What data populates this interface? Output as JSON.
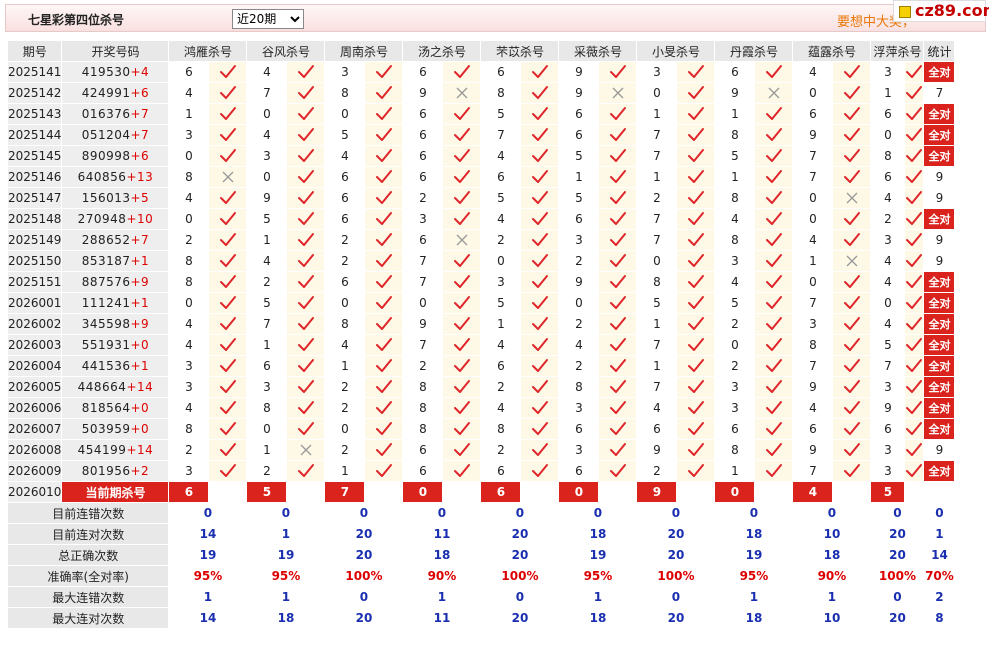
{
  "header": {
    "title": "七星彩第四位杀号",
    "select_value": "近20期",
    "promo": "要想中大奖，",
    "logo": "cz89.com"
  },
  "columns": {
    "period": "期号",
    "draw": "开奖号码",
    "experts": [
      "鸿雁杀号",
      "谷风杀号",
      "周南杀号",
      "汤之杀号",
      "芣苡杀号",
      "采薇杀号",
      "小旻杀号",
      "丹霞杀号",
      "蕴露杀号",
      "浮萍杀号"
    ],
    "stat": "统计"
  },
  "rows": [
    {
      "period": "2025141",
      "nums": "419530",
      "plus": "+4",
      "kills": [
        6,
        4,
        3,
        6,
        6,
        9,
        3,
        6,
        4,
        3
      ],
      "ok": [
        1,
        1,
        1,
        1,
        1,
        1,
        1,
        1,
        1,
        1
      ],
      "stat": "全对"
    },
    {
      "period": "2025142",
      "nums": "424991",
      "plus": "+6",
      "kills": [
        4,
        7,
        8,
        9,
        8,
        9,
        0,
        9,
        0,
        1
      ],
      "ok": [
        1,
        1,
        1,
        0,
        1,
        0,
        1,
        0,
        1,
        1
      ],
      "stat": "7"
    },
    {
      "period": "2025143",
      "nums": "016376",
      "plus": "+7",
      "kills": [
        1,
        0,
        0,
        6,
        5,
        6,
        1,
        1,
        6,
        6
      ],
      "ok": [
        1,
        1,
        1,
        1,
        1,
        1,
        1,
        1,
        1,
        1
      ],
      "stat": "全对"
    },
    {
      "period": "2025144",
      "nums": "051204",
      "plus": "+7",
      "kills": [
        3,
        4,
        5,
        6,
        7,
        6,
        7,
        8,
        9,
        0
      ],
      "ok": [
        1,
        1,
        1,
        1,
        1,
        1,
        1,
        1,
        1,
        1
      ],
      "stat": "全对"
    },
    {
      "period": "2025145",
      "nums": "890998",
      "plus": "+6",
      "kills": [
        0,
        3,
        4,
        6,
        4,
        5,
        7,
        5,
        7,
        8
      ],
      "ok": [
        1,
        1,
        1,
        1,
        1,
        1,
        1,
        1,
        1,
        1
      ],
      "stat": "全对"
    },
    {
      "period": "2025146",
      "nums": "640856",
      "plus": "+13",
      "kills": [
        8,
        0,
        6,
        6,
        6,
        1,
        1,
        1,
        7,
        6
      ],
      "ok": [
        0,
        1,
        1,
        1,
        1,
        1,
        1,
        1,
        1,
        1
      ],
      "stat": "9"
    },
    {
      "period": "2025147",
      "nums": "156013",
      "plus": "+5",
      "kills": [
        4,
        9,
        6,
        2,
        5,
        5,
        2,
        8,
        0,
        4
      ],
      "ok": [
        1,
        1,
        1,
        1,
        1,
        1,
        1,
        1,
        0,
        1
      ],
      "stat": "9"
    },
    {
      "period": "2025148",
      "nums": "270948",
      "plus": "+10",
      "kills": [
        0,
        5,
        6,
        3,
        4,
        6,
        7,
        4,
        0,
        2
      ],
      "ok": [
        1,
        1,
        1,
        1,
        1,
        1,
        1,
        1,
        1,
        1
      ],
      "stat": "全对"
    },
    {
      "period": "2025149",
      "nums": "288652",
      "plus": "+7",
      "kills": [
        2,
        1,
        2,
        6,
        2,
        3,
        7,
        8,
        4,
        3
      ],
      "ok": [
        1,
        1,
        1,
        0,
        1,
        1,
        1,
        1,
        1,
        1
      ],
      "stat": "9"
    },
    {
      "period": "2025150",
      "nums": "853187",
      "plus": "+1",
      "kills": [
        8,
        4,
        2,
        7,
        0,
        2,
        0,
        3,
        1,
        4
      ],
      "ok": [
        1,
        1,
        1,
        1,
        1,
        1,
        1,
        1,
        0,
        1
      ],
      "stat": "9"
    },
    {
      "period": "2025151",
      "nums": "887576",
      "plus": "+9",
      "kills": [
        8,
        2,
        6,
        7,
        3,
        9,
        8,
        4,
        0,
        4
      ],
      "ok": [
        1,
        1,
        1,
        1,
        1,
        1,
        1,
        1,
        1,
        1
      ],
      "stat": "全对"
    },
    {
      "period": "2026001",
      "nums": "111241",
      "plus": "+1",
      "kills": [
        0,
        5,
        0,
        0,
        5,
        0,
        5,
        5,
        7,
        0
      ],
      "ok": [
        1,
        1,
        1,
        1,
        1,
        1,
        1,
        1,
        1,
        1
      ],
      "stat": "全对"
    },
    {
      "period": "2026002",
      "nums": "345598",
      "plus": "+9",
      "kills": [
        4,
        7,
        8,
        9,
        1,
        2,
        1,
        2,
        3,
        4
      ],
      "ok": [
        1,
        1,
        1,
        1,
        1,
        1,
        1,
        1,
        1,
        1
      ],
      "stat": "全对"
    },
    {
      "period": "2026003",
      "nums": "551931",
      "plus": "+0",
      "kills": [
        4,
        1,
        4,
        7,
        4,
        4,
        7,
        0,
        8,
        5
      ],
      "ok": [
        1,
        1,
        1,
        1,
        1,
        1,
        1,
        1,
        1,
        1
      ],
      "stat": "全对"
    },
    {
      "period": "2026004",
      "nums": "441536",
      "plus": "+1",
      "kills": [
        3,
        6,
        1,
        2,
        6,
        2,
        1,
        2,
        7,
        7
      ],
      "ok": [
        1,
        1,
        1,
        1,
        1,
        1,
        1,
        1,
        1,
        1
      ],
      "stat": "全对"
    },
    {
      "period": "2026005",
      "nums": "448664",
      "plus": "+14",
      "kills": [
        3,
        3,
        2,
        8,
        2,
        8,
        7,
        3,
        9,
        3
      ],
      "ok": [
        1,
        1,
        1,
        1,
        1,
        1,
        1,
        1,
        1,
        1
      ],
      "stat": "全对"
    },
    {
      "period": "2026006",
      "nums": "818564",
      "plus": "+0",
      "kills": [
        4,
        8,
        2,
        8,
        4,
        3,
        4,
        3,
        4,
        9
      ],
      "ok": [
        1,
        1,
        1,
        1,
        1,
        1,
        1,
        1,
        1,
        1
      ],
      "stat": "全对"
    },
    {
      "period": "2026007",
      "nums": "503959",
      "plus": "+0",
      "kills": [
        8,
        0,
        0,
        8,
        8,
        6,
        6,
        6,
        6,
        6
      ],
      "ok": [
        1,
        1,
        1,
        1,
        1,
        1,
        1,
        1,
        1,
        1
      ],
      "stat": "全对"
    },
    {
      "period": "2026008",
      "nums": "454199",
      "plus": "+14",
      "kills": [
        2,
        1,
        2,
        6,
        2,
        3,
        9,
        8,
        9,
        3
      ],
      "ok": [
        1,
        0,
        1,
        1,
        1,
        1,
        1,
        1,
        1,
        1
      ],
      "stat": "9"
    },
    {
      "period": "2026009",
      "nums": "801956",
      "plus": "+2",
      "kills": [
        3,
        2,
        1,
        6,
        6,
        6,
        2,
        1,
        7,
        3
      ],
      "ok": [
        1,
        1,
        1,
        1,
        1,
        1,
        1,
        1,
        1,
        1
      ],
      "stat": "全对"
    }
  ],
  "current": {
    "period": "2026010",
    "label": "当前期杀号",
    "kills": [
      "6",
      "5",
      "7",
      "0",
      "6",
      "0",
      "9",
      "0",
      "4",
      "5"
    ]
  },
  "summary": [
    {
      "label": "目前连错次数",
      "values": [
        "0",
        "0",
        "0",
        "0",
        "0",
        "0",
        "0",
        "0",
        "0",
        "0"
      ],
      "stat": "0",
      "red": false
    },
    {
      "label": "目前连对次数",
      "values": [
        "14",
        "1",
        "20",
        "11",
        "20",
        "18",
        "20",
        "18",
        "10",
        "20"
      ],
      "stat": "1",
      "red": false
    },
    {
      "label": "总正确次数",
      "values": [
        "19",
        "19",
        "20",
        "18",
        "20",
        "19",
        "20",
        "19",
        "18",
        "20"
      ],
      "stat": "14",
      "red": false
    },
    {
      "label": "准确率(全对率)",
      "values": [
        "95%",
        "95%",
        "100%",
        "90%",
        "100%",
        "95%",
        "100%",
        "95%",
        "90%",
        "100%"
      ],
      "stat": "70%",
      "red": true
    },
    {
      "label": "最大连错次数",
      "values": [
        "1",
        "1",
        "0",
        "1",
        "0",
        "1",
        "0",
        "1",
        "1",
        "0"
      ],
      "stat": "2",
      "red": false
    },
    {
      "label": "最大连对次数",
      "values": [
        "14",
        "18",
        "20",
        "11",
        "20",
        "18",
        "20",
        "18",
        "10",
        "20"
      ],
      "stat": "8",
      "red": false
    }
  ],
  "colors": {
    "accent_red": "#d9231c",
    "check": "#e0252a",
    "cross": "#999999",
    "value_blue": "#1a2fb0"
  },
  "icons": {
    "ok": "check-icon",
    "miss": "cross-icon"
  }
}
